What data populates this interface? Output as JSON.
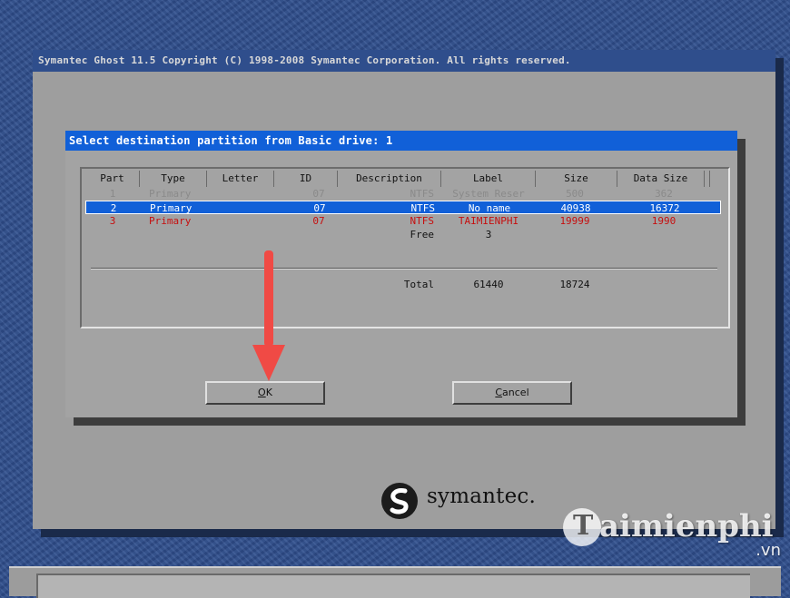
{
  "window": {
    "title": "Symantec Ghost 11.5   Copyright (C) 1998-2008 Symantec Corporation. All rights reserved."
  },
  "dialog": {
    "title": "Select destination partition from Basic drive: 1"
  },
  "table": {
    "columns": [
      "Part",
      "Type",
      "Letter",
      "ID",
      "Description",
      "Label",
      "Size",
      "Data Size"
    ],
    "rows": [
      {
        "part": "1",
        "type": "Primary",
        "id": "07",
        "description": "NTFS",
        "label": "System Reser",
        "size": "500",
        "data_size": "362",
        "state": "disabled"
      },
      {
        "part": "2",
        "type": "Primary",
        "id": "07",
        "description": "NTFS",
        "label": "No name",
        "size": "40938",
        "data_size": "16372",
        "state": "selected"
      },
      {
        "part": "3",
        "type": "Primary",
        "id": "07",
        "description": "NTFS",
        "label": "TAIMIENPHI",
        "size": "19999",
        "data_size": "1990",
        "state": "highlighted"
      },
      {
        "description": "Free",
        "label": "3"
      }
    ],
    "total": {
      "description": "Total",
      "label": "61440",
      "size": "18724"
    }
  },
  "buttons": {
    "ok": {
      "accel": "O",
      "rest": "K"
    },
    "cancel": {
      "accel": "C",
      "rest": "ancel"
    }
  },
  "brand": {
    "logo_text": "symantec."
  },
  "watermark": {
    "text": "aimienphi",
    "suffix": ".vn"
  },
  "colors": {
    "desktop": "#2f4e8c",
    "selection": "#1160d8",
    "highlight_red": "#c60f0f",
    "arrow_red": "#f04a45"
  }
}
